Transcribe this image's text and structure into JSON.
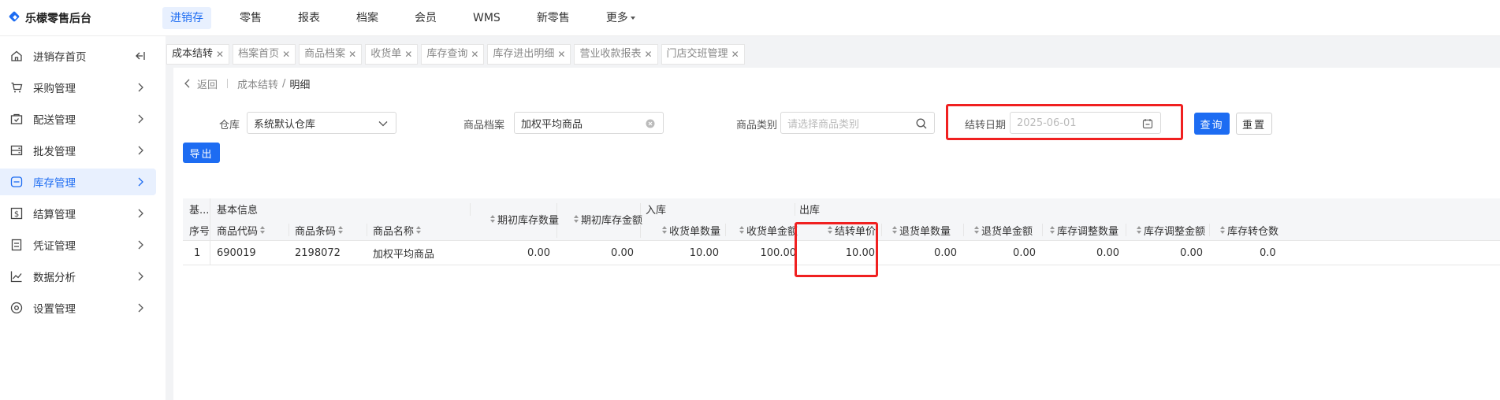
{
  "app": {
    "title": "乐檬零售后台",
    "brand_color": "#1d6cf2"
  },
  "topnav": [
    {
      "label": "进销存",
      "active": true
    },
    {
      "label": "零售"
    },
    {
      "label": "报表"
    },
    {
      "label": "档案"
    },
    {
      "label": "会员"
    },
    {
      "label": "WMS"
    },
    {
      "label": "新零售"
    },
    {
      "label": "更多"
    }
  ],
  "sidebar": [
    {
      "label": "进销存首页",
      "icon": "home-icon"
    },
    {
      "label": "采购管理",
      "icon": "cart-icon"
    },
    {
      "label": "配送管理",
      "icon": "delivery-icon"
    },
    {
      "label": "批发管理",
      "icon": "wholesale-icon"
    },
    {
      "label": "库存管理",
      "icon": "inventory-icon",
      "active": true
    },
    {
      "label": "结算管理",
      "icon": "settlement-icon"
    },
    {
      "label": "凭证管理",
      "icon": "voucher-icon"
    },
    {
      "label": "数据分析",
      "icon": "chart-icon"
    },
    {
      "label": "设置管理",
      "icon": "settings-icon"
    }
  ],
  "tabs": [
    {
      "label": "成本结转",
      "active": true
    },
    {
      "label": "档案首页"
    },
    {
      "label": "商品档案"
    },
    {
      "label": "收货单"
    },
    {
      "label": "库存查询"
    },
    {
      "label": "库存进出明细"
    },
    {
      "label": "营业收款报表"
    },
    {
      "label": "门店交班管理"
    }
  ],
  "breadcrumb": {
    "back": "返回",
    "parent": "成本结转",
    "sep": "/",
    "current": "明细"
  },
  "form": {
    "warehouse_label": "仓库",
    "warehouse_value": "系统默认仓库",
    "product_label": "商品档案",
    "product_value": "加权平均商品",
    "category_label": "商品类别",
    "category_placeholder": "请选择商品类别",
    "date_label": "结转日期",
    "date_value": "2025-06-01",
    "query_button": "查询",
    "reset_button": "重置",
    "export_button": "导出"
  },
  "table": {
    "group_headers": {
      "collapsed": "基...",
      "basic": "基本信息",
      "inbound": "入库",
      "outbound": "出库"
    },
    "columns": {
      "seq": "序号",
      "code": "商品代码",
      "barcode": "商品条码",
      "name": "商品名称",
      "open_qty": "期初库存数量",
      "open_amt": "期初库存金额",
      "recv_qty": "收货单数量",
      "recv_amt": "收货单金额",
      "unit_cost": "结转单价",
      "ret_qty": "退货单数量",
      "ret_amt": "退货单金额",
      "adj_qty": "库存调整数量",
      "adj_amt": "库存调整金额",
      "transfer_qty": "库存转仓数"
    },
    "rows": [
      {
        "seq": "1",
        "code": "690019",
        "barcode": "2198072",
        "name": "加权平均商品",
        "open_qty": "0.00",
        "open_amt": "0.00",
        "recv_qty": "10.00",
        "recv_amt": "100.00",
        "unit_cost": "10.00",
        "ret_qty": "0.00",
        "ret_amt": "0.00",
        "adj_qty": "0.00",
        "adj_amt": "0.00",
        "transfer_qty": "0.0"
      }
    ]
  },
  "highlight_color": "#f02020"
}
